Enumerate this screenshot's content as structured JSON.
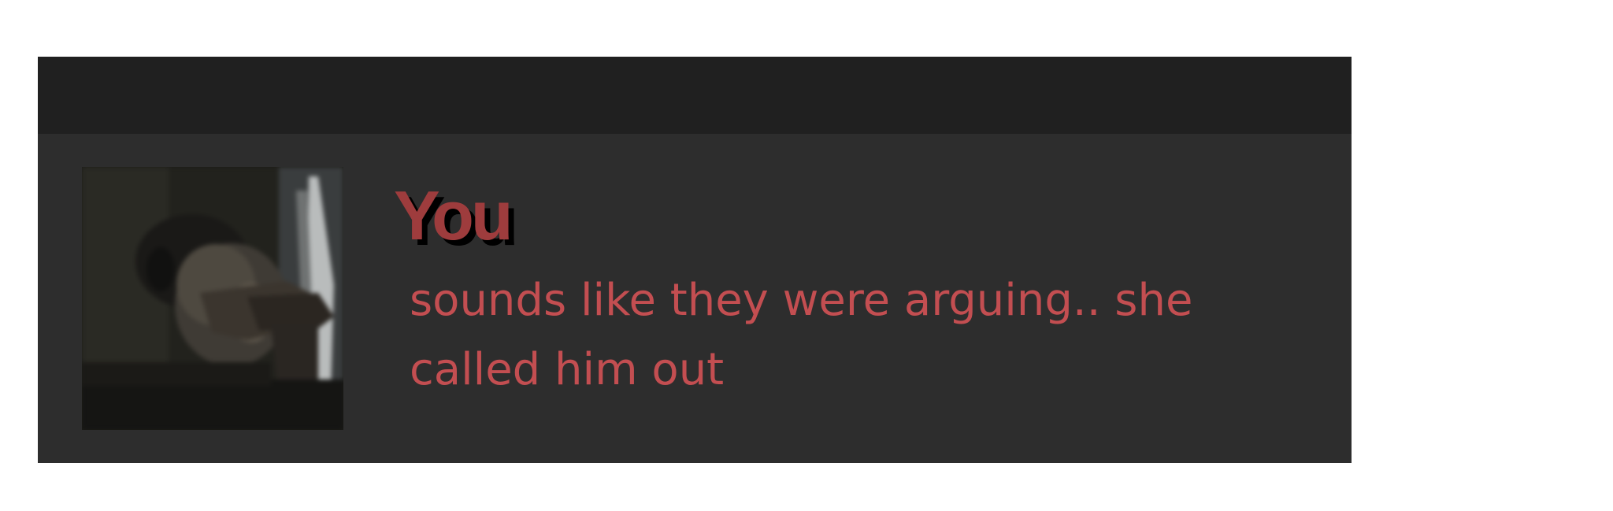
{
  "message": {
    "sender": "You",
    "text": "sounds like they were arguing.. she called him out",
    "avatar_icon": "user-photo-avatar"
  },
  "colors": {
    "card_background": "#2d2d2d",
    "header_background": "#202020",
    "sender_color": "#9e3c3d",
    "text_color": "#c34e51",
    "page_background": "#ffffff"
  }
}
